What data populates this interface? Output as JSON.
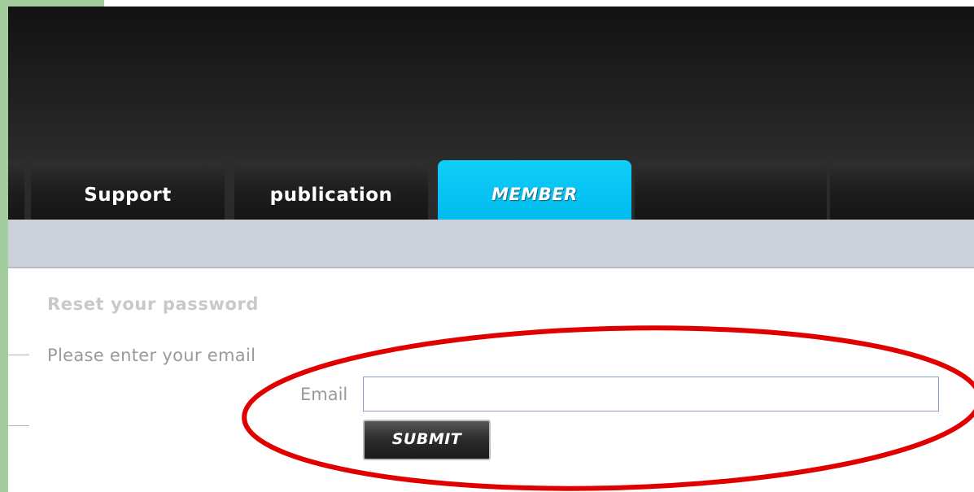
{
  "nav": {
    "tabs": [
      {
        "label": "Support",
        "active": false
      },
      {
        "label": "publication",
        "active": false
      },
      {
        "label": "MEMBER",
        "active": true
      },
      {
        "label": "",
        "active": false
      },
      {
        "label": "",
        "active": false
      }
    ]
  },
  "reset_form": {
    "title": "Reset your password",
    "instructions": "Please enter your email",
    "email_label": "Email",
    "email_value": "",
    "submit_label": "SUBMIT"
  },
  "colors": {
    "active_tab": "#00bcef",
    "header_bg": "#1c1c1c",
    "subbar_bg": "#cbd1d8",
    "sidebar_strip": "#a3cd9d",
    "annotation": "#e00000"
  }
}
